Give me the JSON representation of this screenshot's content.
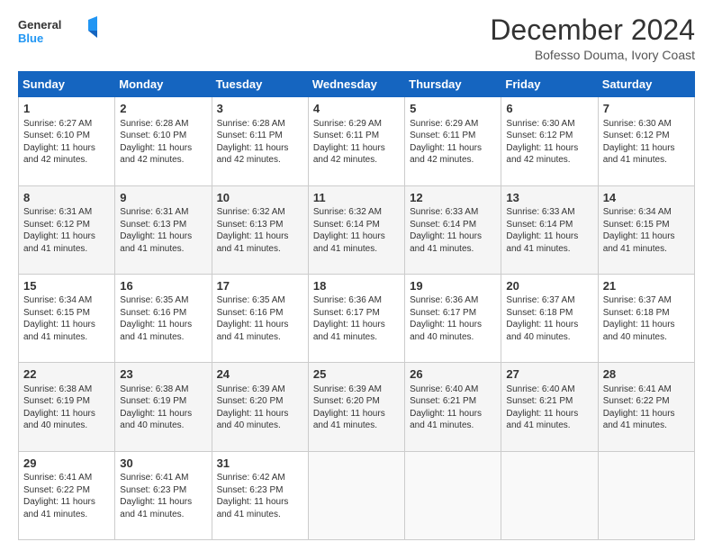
{
  "logo": {
    "line1": "General",
    "line2": "Blue"
  },
  "header": {
    "month": "December 2024",
    "location": "Bofesso Douma, Ivory Coast"
  },
  "days": [
    "Sunday",
    "Monday",
    "Tuesday",
    "Wednesday",
    "Thursday",
    "Friday",
    "Saturday"
  ],
  "weeks": [
    [
      {
        "day": "1",
        "rise": "6:27 AM",
        "set": "6:10 PM",
        "daylight": "11 hours and 42 minutes."
      },
      {
        "day": "2",
        "rise": "6:28 AM",
        "set": "6:10 PM",
        "daylight": "11 hours and 42 minutes."
      },
      {
        "day": "3",
        "rise": "6:28 AM",
        "set": "6:11 PM",
        "daylight": "11 hours and 42 minutes."
      },
      {
        "day": "4",
        "rise": "6:29 AM",
        "set": "6:11 PM",
        "daylight": "11 hours and 42 minutes."
      },
      {
        "day": "5",
        "rise": "6:29 AM",
        "set": "6:11 PM",
        "daylight": "11 hours and 42 minutes."
      },
      {
        "day": "6",
        "rise": "6:30 AM",
        "set": "6:12 PM",
        "daylight": "11 hours and 42 minutes."
      },
      {
        "day": "7",
        "rise": "6:30 AM",
        "set": "6:12 PM",
        "daylight": "11 hours and 41 minutes."
      }
    ],
    [
      {
        "day": "8",
        "rise": "6:31 AM",
        "set": "6:12 PM",
        "daylight": "11 hours and 41 minutes."
      },
      {
        "day": "9",
        "rise": "6:31 AM",
        "set": "6:13 PM",
        "daylight": "11 hours and 41 minutes."
      },
      {
        "day": "10",
        "rise": "6:32 AM",
        "set": "6:13 PM",
        "daylight": "11 hours and 41 minutes."
      },
      {
        "day": "11",
        "rise": "6:32 AM",
        "set": "6:14 PM",
        "daylight": "11 hours and 41 minutes."
      },
      {
        "day": "12",
        "rise": "6:33 AM",
        "set": "6:14 PM",
        "daylight": "11 hours and 41 minutes."
      },
      {
        "day": "13",
        "rise": "6:33 AM",
        "set": "6:14 PM",
        "daylight": "11 hours and 41 minutes."
      },
      {
        "day": "14",
        "rise": "6:34 AM",
        "set": "6:15 PM",
        "daylight": "11 hours and 41 minutes."
      }
    ],
    [
      {
        "day": "15",
        "rise": "6:34 AM",
        "set": "6:15 PM",
        "daylight": "11 hours and 41 minutes."
      },
      {
        "day": "16",
        "rise": "6:35 AM",
        "set": "6:16 PM",
        "daylight": "11 hours and 41 minutes."
      },
      {
        "day": "17",
        "rise": "6:35 AM",
        "set": "6:16 PM",
        "daylight": "11 hours and 41 minutes."
      },
      {
        "day": "18",
        "rise": "6:36 AM",
        "set": "6:17 PM",
        "daylight": "11 hours and 41 minutes."
      },
      {
        "day": "19",
        "rise": "6:36 AM",
        "set": "6:17 PM",
        "daylight": "11 hours and 40 minutes."
      },
      {
        "day": "20",
        "rise": "6:37 AM",
        "set": "6:18 PM",
        "daylight": "11 hours and 40 minutes."
      },
      {
        "day": "21",
        "rise": "6:37 AM",
        "set": "6:18 PM",
        "daylight": "11 hours and 40 minutes."
      }
    ],
    [
      {
        "day": "22",
        "rise": "6:38 AM",
        "set": "6:19 PM",
        "daylight": "11 hours and 40 minutes."
      },
      {
        "day": "23",
        "rise": "6:38 AM",
        "set": "6:19 PM",
        "daylight": "11 hours and 40 minutes."
      },
      {
        "day": "24",
        "rise": "6:39 AM",
        "set": "6:20 PM",
        "daylight": "11 hours and 40 minutes."
      },
      {
        "day": "25",
        "rise": "6:39 AM",
        "set": "6:20 PM",
        "daylight": "11 hours and 41 minutes."
      },
      {
        "day": "26",
        "rise": "6:40 AM",
        "set": "6:21 PM",
        "daylight": "11 hours and 41 minutes."
      },
      {
        "day": "27",
        "rise": "6:40 AM",
        "set": "6:21 PM",
        "daylight": "11 hours and 41 minutes."
      },
      {
        "day": "28",
        "rise": "6:41 AM",
        "set": "6:22 PM",
        "daylight": "11 hours and 41 minutes."
      }
    ],
    [
      {
        "day": "29",
        "rise": "6:41 AM",
        "set": "6:22 PM",
        "daylight": "11 hours and 41 minutes."
      },
      {
        "day": "30",
        "rise": "6:41 AM",
        "set": "6:23 PM",
        "daylight": "11 hours and 41 minutes."
      },
      {
        "day": "31",
        "rise": "6:42 AM",
        "set": "6:23 PM",
        "daylight": "11 hours and 41 minutes."
      },
      null,
      null,
      null,
      null
    ]
  ],
  "labels": {
    "sunrise": "Sunrise:",
    "sunset": "Sunset:",
    "daylight": "Daylight: "
  }
}
